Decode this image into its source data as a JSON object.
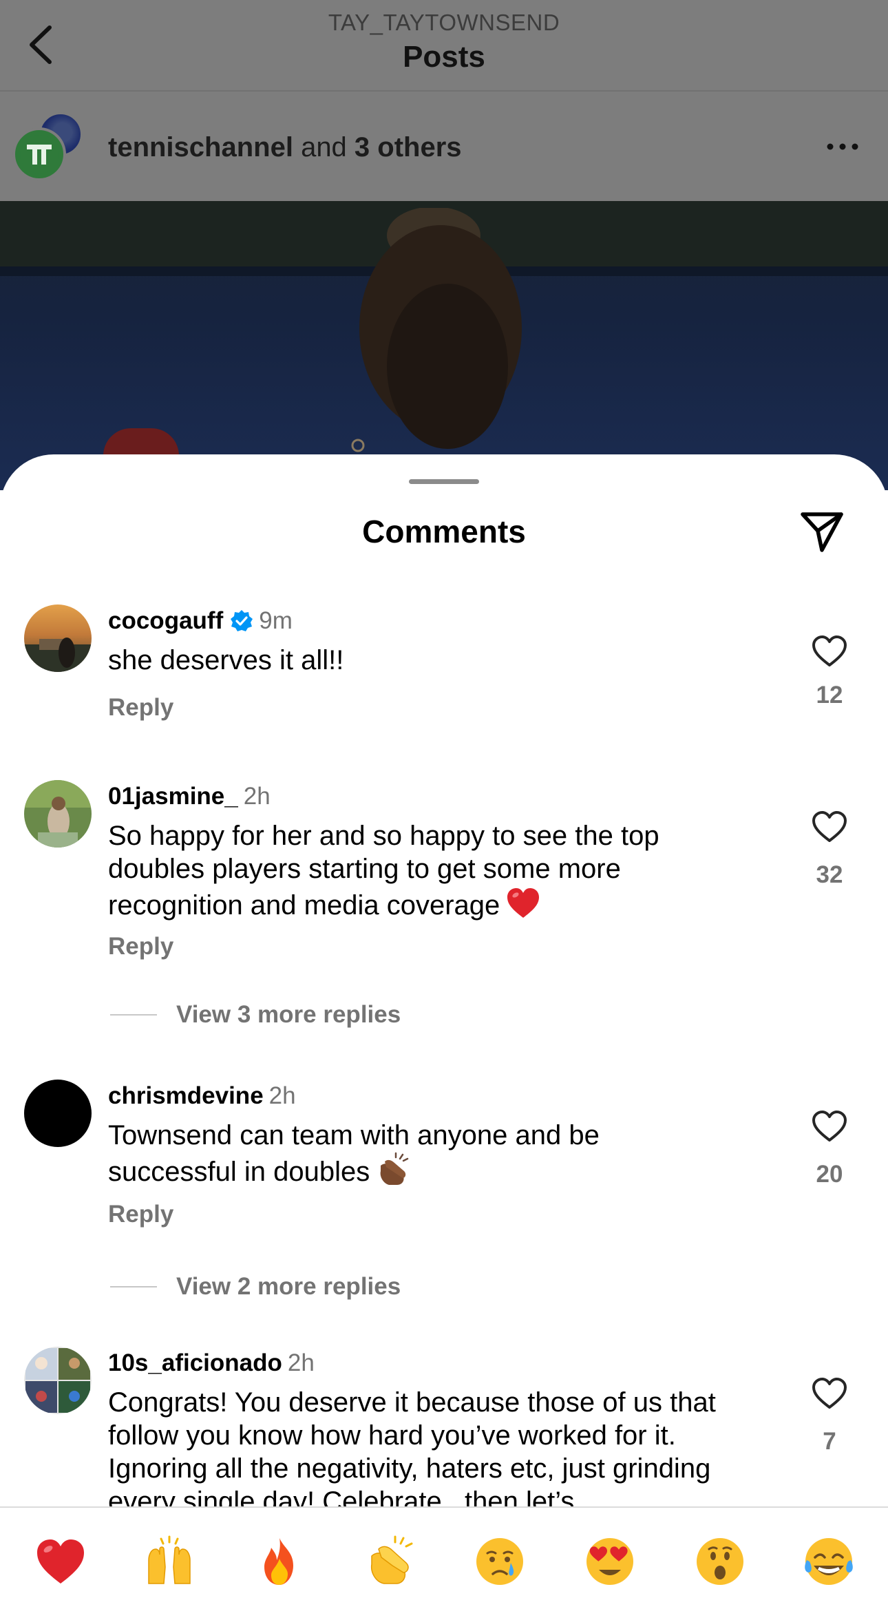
{
  "nav": {
    "username": "TAY_TAYTOWNSEND",
    "title": "Posts"
  },
  "post": {
    "collab_user": "tennischannel",
    "collab_rest": " and ",
    "collab_others": "3 others"
  },
  "sheet": {
    "title": "Comments"
  },
  "comments": [
    {
      "username": "cocogauff",
      "verified": true,
      "time": "9m",
      "text": "she deserves it all!!",
      "reply_label": "Reply",
      "likes": "12"
    },
    {
      "username": "01jasmine_",
      "time": "2h",
      "text": "So happy for her and so happy to see the top doubles players starting to get some more recognition and media coverage",
      "emoji": "red-heart",
      "reply_label": "Reply",
      "likes": "32",
      "view_replies": "View 3 more replies"
    },
    {
      "username": "chrismdevine",
      "time": "2h",
      "text": "Townsend can team with anyone and be successful in doubles",
      "emoji": "clapping-hands-dark",
      "reply_label": "Reply",
      "likes": "20",
      "view_replies": "View 2 more replies"
    },
    {
      "username": "10s_aficionado",
      "time": "2h",
      "text": "Congrats! You deserve it because those of us that follow you know how hard you’ve worked for it. Ignoring all the negativity, haters etc, just grinding every single day! Celebrate , then let’s",
      "likes": "7"
    }
  ],
  "emoji_bar": [
    "red-heart-icon",
    "raising-hands-icon",
    "fire-icon",
    "clapping-hands-icon",
    "crying-face-icon",
    "heart-eyes-icon",
    "surprised-face-icon",
    "tears-of-joy-icon"
  ],
  "colors": {
    "secondary_text": "#737373",
    "verified_blue": "#0095f6",
    "overlay": "#7d7d7d"
  }
}
